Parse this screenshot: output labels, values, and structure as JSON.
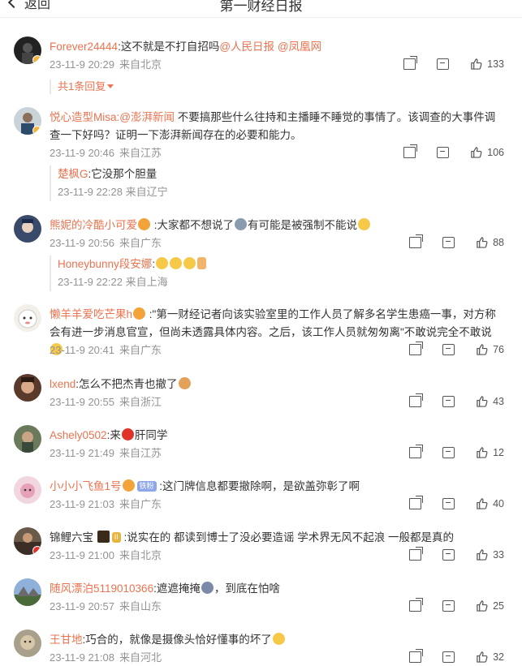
{
  "header": {
    "back_label": "返回",
    "title": "第一财经日报"
  },
  "comments": [
    {
      "user": "Forever24444",
      "text_pre": ":这不就是不打自招吗",
      "mentions": [
        "@人民日报",
        "@凤凰网"
      ],
      "time": "23-11-9 20:29",
      "location": "来自北京",
      "likes": "133",
      "reply_toggle": "共1条回复"
    },
    {
      "user": "悦心造型Misa",
      "mention": ":@澎湃新闻",
      "text": " 不要搞那些什么往持和主播睡不睡觉的事情了。该调查的大事件调查一下好吗？证明一下澎湃新闻存在的必要和能力。",
      "time": "23-11-9 20:46",
      "location": "来自江苏",
      "likes": "106",
      "reply": {
        "user": "楚枫G",
        "text": ":它没那个胆量",
        "time": "23-11-9 22:28",
        "location": "来自辽宁"
      }
    },
    {
      "user": "熊妮的冷酷小可爱",
      "text": ":大家都不想说了",
      "text2": "有可能是被强制不能说",
      "time": "23-11-9 20:56",
      "location": "来自广东",
      "likes": "88",
      "reply": {
        "user": "Honeybunny段安娜",
        "text": ":",
        "time": "23-11-9 22:22",
        "location": "来自上海"
      }
    },
    {
      "user": "懒羊羊爱吃芒果h",
      "text": ":\"第一财经记者向该实验室里的工作人员了解多名学生患癌一事，对方称会有进一步消息官宣，但尚未透露具体内容。之后，该工作人员就匆匆离\"不敢说完全不敢说",
      "time": "23-11-9 20:41",
      "location": "来自广东",
      "likes": "76"
    },
    {
      "user": "lxend",
      "text": ":怎么不把杰青也撤了",
      "time": "23-11-9 20:55",
      "location": "来自浙江",
      "likes": "43"
    },
    {
      "user": "Ashely0502",
      "text": ":来",
      "text2": "肝同学",
      "time": "23-11-9 21:49",
      "location": "来自江苏",
      "likes": "12"
    },
    {
      "user": "小小小飞鱼1号",
      "badge": "铁粉",
      "text": ":这门牌信息都要撤除啊，是欲盖弥彰了啊",
      "time": "23-11-9 21:03",
      "location": "来自广东",
      "likes": "40"
    },
    {
      "user": "锦鲤六宝",
      "badge": "II",
      "text": ":说实在的 都读到博士了没必要造谣 学术界无风不起浪 一般都是真的",
      "time": "23-11-9 21:00",
      "location": "来自北京",
      "likes": "33"
    },
    {
      "user": "随风漂泊5119010366",
      "text": ":遮遮掩掩",
      "text2": "，到底在怕啥",
      "time": "23-11-9 20:57",
      "location": "来自山东",
      "likes": "25"
    },
    {
      "user": "王甘地",
      "text": ":巧合的，就像是摄像头恰好懂事的坏了",
      "time": "23-11-9 21:08",
      "location": "来自河北",
      "likes": "32"
    }
  ],
  "colors": {
    "accent": "#eb7350",
    "meta": "#939393"
  }
}
